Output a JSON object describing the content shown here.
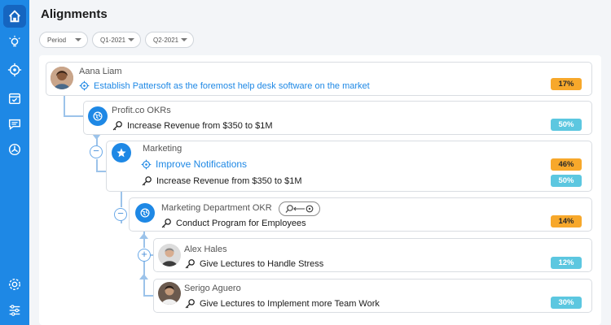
{
  "page": {
    "title": "Alignments"
  },
  "filters": [
    {
      "label": "Period"
    },
    {
      "label": "Q1-2021"
    },
    {
      "label": "Q2-2021"
    }
  ],
  "sidebar": {
    "top_icons": [
      "home-icon",
      "lightbulb-icon",
      "target-icon",
      "calendar-check-icon",
      "chat-icon",
      "dashboard-icon"
    ],
    "bottom_icons": [
      "settings-icon",
      "sliders-icon"
    ]
  },
  "cards": [
    {
      "owner": "Aana Liam",
      "objective": "Establish Pattersoft as the foremost help desk software on the market",
      "badge": "17%"
    },
    {
      "owner": "Profit.co OKRs",
      "key_result": "Increase Revenue from $350 to $1M",
      "badge": "50%"
    },
    {
      "owner": "Marketing",
      "objective": "Improve Notifications",
      "objective_badge": "46%",
      "key_result": "Increase Revenue from $350 to $1M",
      "kr_badge": "50%"
    },
    {
      "owner": "Marketing Department OKR",
      "key_result": "Conduct Program for Employees",
      "badge": "14%"
    },
    {
      "owner": "Alex Hales",
      "key_result": "Give Lectures to Handle Stress",
      "badge": "12%"
    },
    {
      "owner": "Serigo Aguero",
      "key_result": "Give Lectures to Implement more Team Work",
      "badge": "30%"
    }
  ],
  "colors": {
    "primary": "#1e88e5",
    "orange": "#f7a82b",
    "teal": "#5cc7e0",
    "sidebar": "#1e88e5"
  }
}
